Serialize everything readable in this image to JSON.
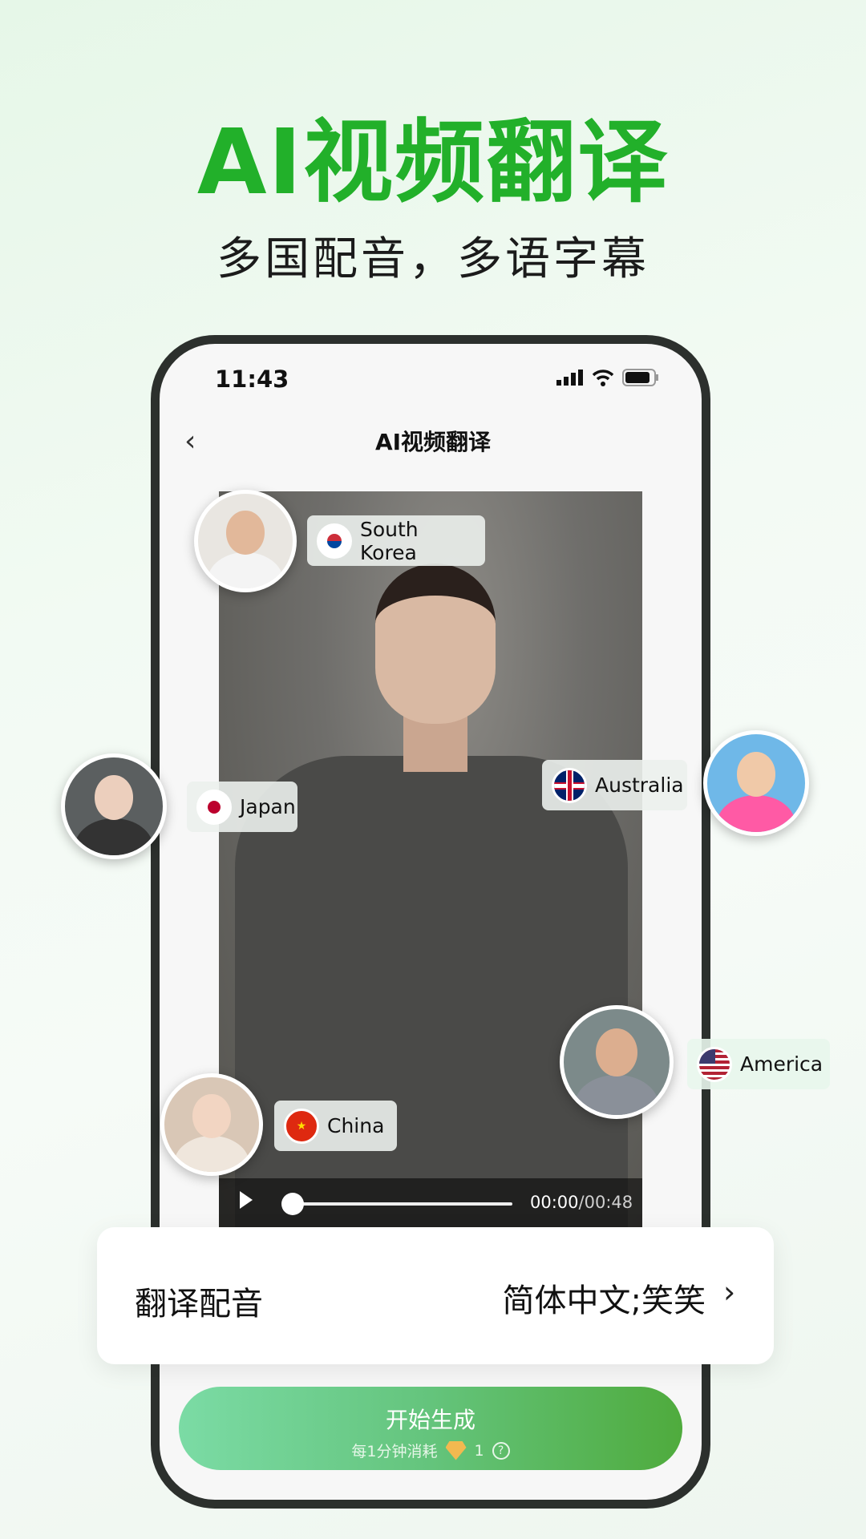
{
  "hero": {
    "title": "AI视频翻译",
    "subtitle": "多国配音，多语字幕"
  },
  "status_bar": {
    "time": "11:43",
    "icons": [
      "signal-icon",
      "wifi-icon",
      "battery-icon"
    ]
  },
  "nav": {
    "title": "AI视频翻译",
    "back_icon": "chevron-left-icon"
  },
  "video": {
    "current_time": "00:00",
    "separator": "/",
    "duration": "00:48",
    "progress": 0
  },
  "voices": [
    {
      "country": "South Korea",
      "flag": "south-korea-flag-icon"
    },
    {
      "country": "Japan",
      "flag": "japan-flag-icon"
    },
    {
      "country": "Australia",
      "flag": "australia-flag-icon"
    },
    {
      "country": "America",
      "flag": "usa-flag-icon"
    },
    {
      "country": "China",
      "flag": "china-flag-icon"
    }
  ],
  "settings": {
    "label": "翻译配音",
    "value": "简体中文;笑笑"
  },
  "start_button": {
    "label": "开始生成",
    "cost_text": "每1分钟消耗",
    "cost_value": "1",
    "help": "?"
  },
  "colors": {
    "accent": "#22b02a",
    "button_start": "#7bdba5",
    "button_end": "#4fab3d"
  }
}
